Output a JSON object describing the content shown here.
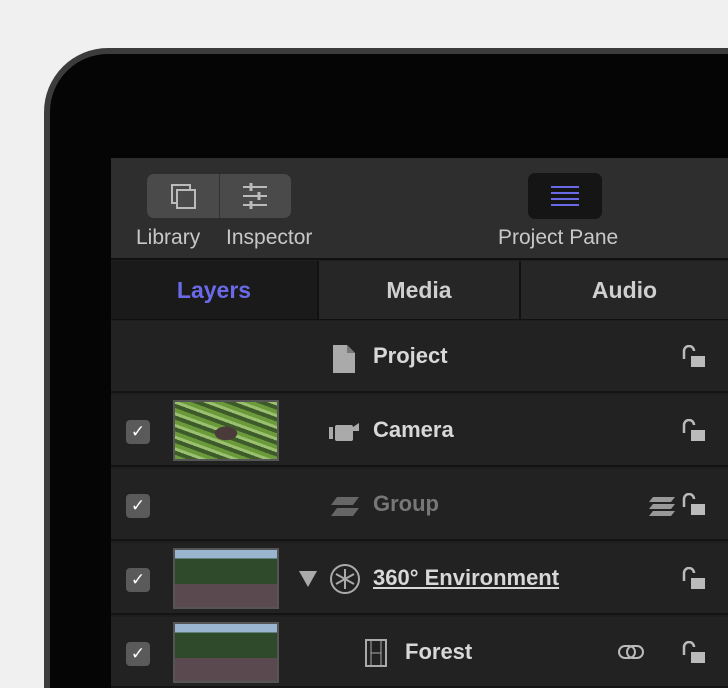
{
  "toolbar": {
    "library": "Library",
    "inspector": "Inspector",
    "project_pane": "Project Pane"
  },
  "tabs": [
    {
      "label": "Layers",
      "active": true
    },
    {
      "label": "Media"
    },
    {
      "label": "Audio"
    }
  ],
  "layers": [
    {
      "name": "Project",
      "icon": "document-icon",
      "checked": null
    },
    {
      "name": "Camera",
      "icon": "camera-icon",
      "checked": true
    },
    {
      "name": "Group",
      "icon": "group-layers-icon",
      "checked": true
    },
    {
      "name": "360° Environment",
      "icon": "360-environment-icon",
      "checked": true,
      "expanded": true
    },
    {
      "name": "Forest",
      "icon": "film-icon",
      "checked": true
    }
  ],
  "colors": {
    "accent": "#6a6ae8"
  }
}
